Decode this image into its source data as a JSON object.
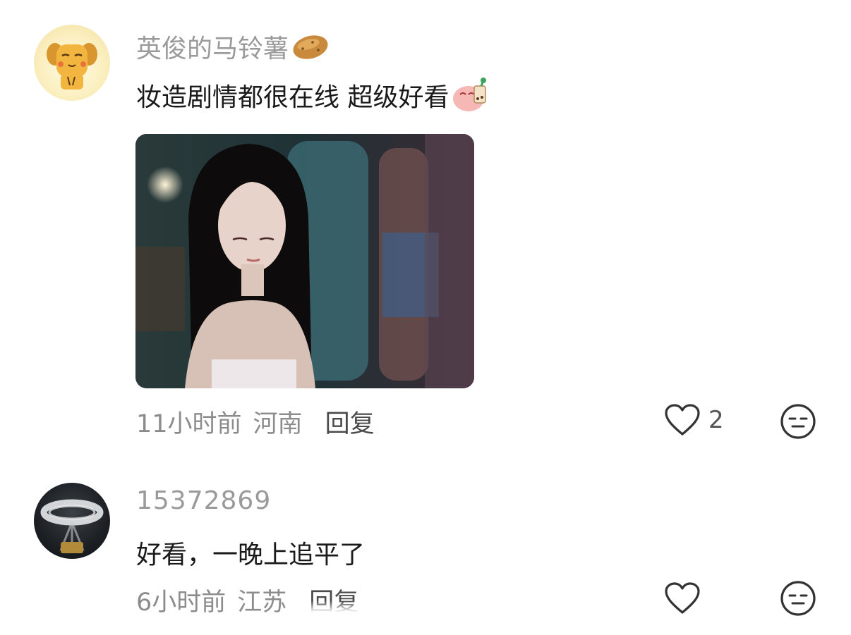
{
  "comments": [
    {
      "username": "英俊的马铃薯",
      "username_emoji": "potato-icon",
      "text": "妆造剧情都很在线 超级好看",
      "text_emoji": "bubble-tea-icon",
      "has_image": true,
      "time": "11小时前",
      "location": "河南",
      "reply_label": "回复",
      "like_count": "2"
    },
    {
      "username": "15372869",
      "text": "好看，一晚上追平了",
      "time": "6小时前",
      "location": "江苏",
      "reply_label": "回复",
      "like_count": ""
    }
  ]
}
